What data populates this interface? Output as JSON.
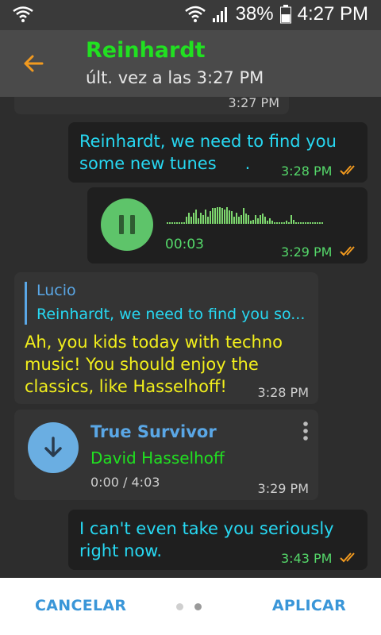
{
  "status_bar": {
    "battery_percent": "38%",
    "time": "4:27 PM"
  },
  "header": {
    "title": "Reinhardt",
    "subtitle": "últ. vez a las 3:27 PM"
  },
  "messages": [
    {
      "type": "time-stub",
      "time": "3:27 PM"
    },
    {
      "type": "text",
      "direction": "out",
      "text_line1": "Reinhardt, we need to find you",
      "text_line2": "some new tunes",
      "text_tail": ".",
      "time": "3:28 PM"
    },
    {
      "type": "voice",
      "direction": "out",
      "duration": "00:03",
      "time": "3:29 PM"
    },
    {
      "type": "reply",
      "direction": "in",
      "reply_author": "Lucio",
      "reply_text": "Reinhardt, we need to find you so...",
      "text_line1": "Ah, you kids today with techno",
      "text_line2": "music! You should enjoy the",
      "text_line3": "classics, like Hasselhoff!",
      "time": "3:28 PM"
    },
    {
      "type": "audio",
      "direction": "in",
      "track_title": "True Survivor",
      "artist": "David Hasselhoff",
      "progress": "0:00 / 4:03",
      "time": "3:29 PM"
    },
    {
      "type": "text",
      "direction": "out",
      "text_line1": "I can't even take you seriously",
      "text_line2": "right now.",
      "time": "3:43 PM"
    }
  ],
  "bottom_bar": {
    "cancel_label": "CANCELAR",
    "apply_label": "APLICAR",
    "page_count": 2,
    "active_page": 2
  },
  "colors": {
    "accent_green": "#21e021",
    "message_cyan": "#27d8f2",
    "message_yellow": "#f2ef1c",
    "link_blue": "#3a96d8",
    "back_orange": "#f29a1f"
  }
}
